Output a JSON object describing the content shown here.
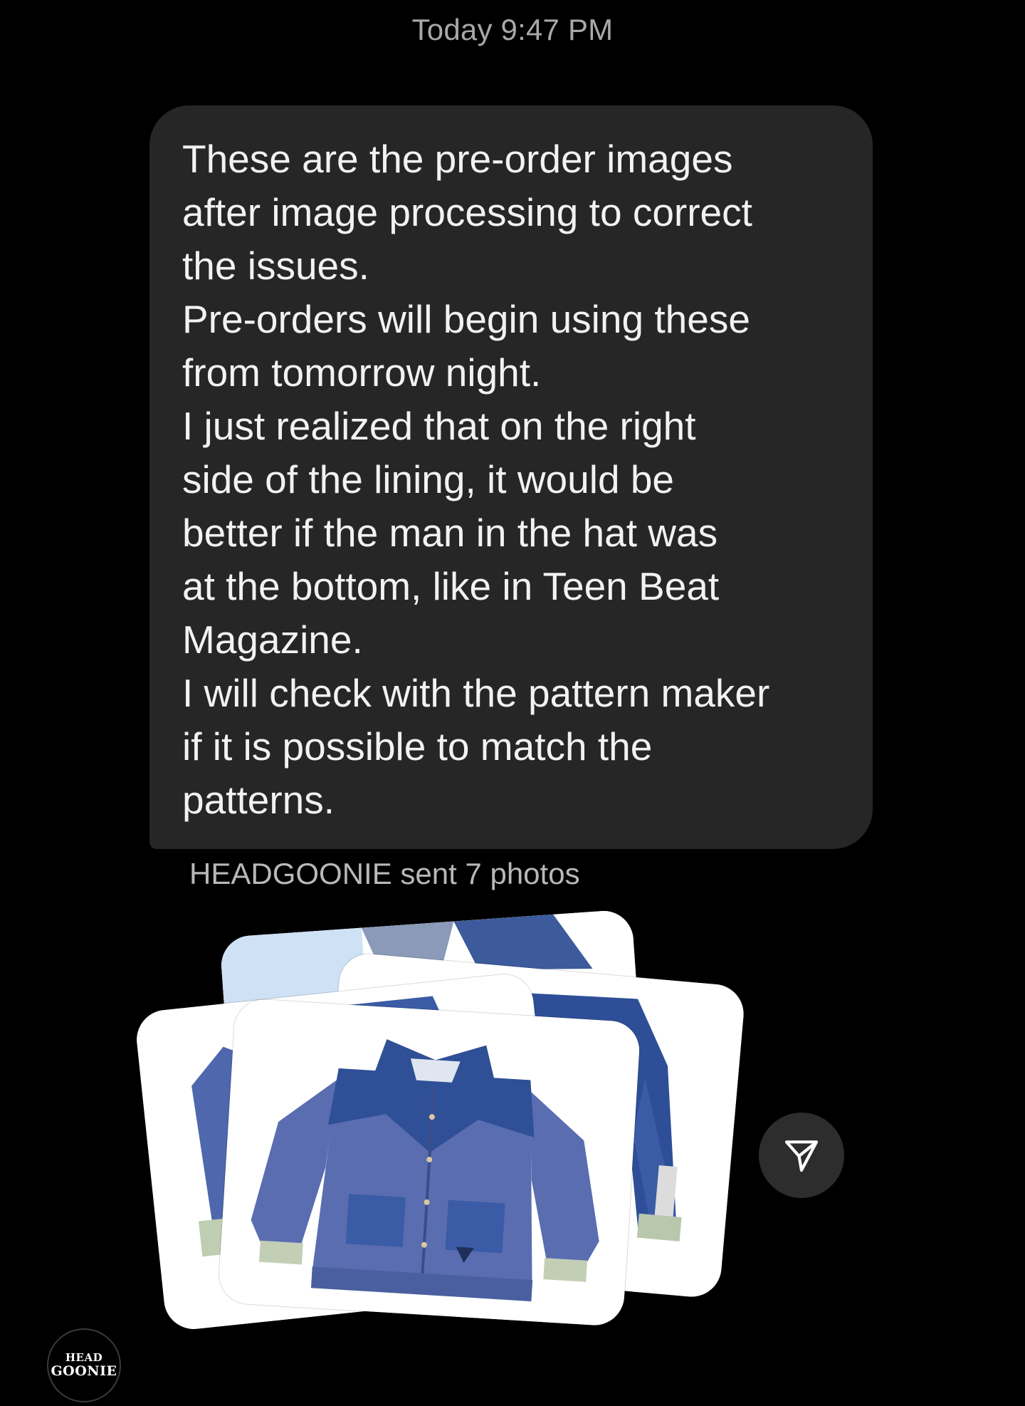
{
  "header": {
    "timestamp": "Today 9:47 PM"
  },
  "message": {
    "lines": [
      "These are the pre-order images",
      "after image processing to correct",
      "the issues.",
      "Pre-orders will begin using these",
      "from tomorrow night.",
      "I just realized that on the right",
      "side of the lining, it would be",
      "better if the man in the hat was",
      "at the bottom, like in Teen Beat",
      "Magazine.",
      "I will check with the pattern maker",
      "if it is possible to match the",
      "patterns."
    ]
  },
  "attachment": {
    "caption": "HEADGOONIE sent 7 photos",
    "photo_count": 7
  },
  "share_button": {
    "icon": "paper-plane-icon"
  },
  "avatar": {
    "line1": "HEAD",
    "line2": "GOONIE"
  },
  "colors": {
    "background": "#000000",
    "bubble": "#262626",
    "timestamp_text": "#a8a8a8",
    "caption_text": "#b8b8b8",
    "denim_light": "#5a6db0",
    "denim_dark": "#2f4f97"
  }
}
